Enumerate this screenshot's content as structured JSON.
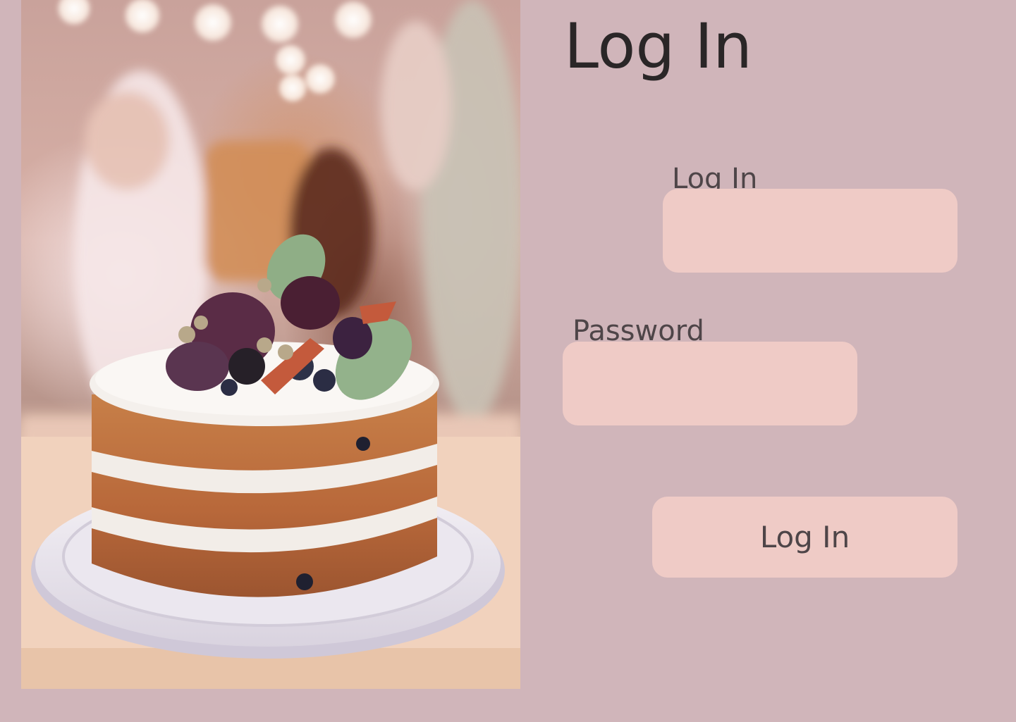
{
  "page": {
    "title": "Log In"
  },
  "hero_image": {
    "description_icon": "cake-photo"
  },
  "form": {
    "login_label": "Log In",
    "login_value": "",
    "password_label": "Password",
    "password_value": "",
    "submit_label": "Log In"
  },
  "colors": {
    "background": "#d0b5ba",
    "field_fill": "#efcbc6",
    "text_dark": "#2a2627",
    "text_label": "#4e4548"
  }
}
